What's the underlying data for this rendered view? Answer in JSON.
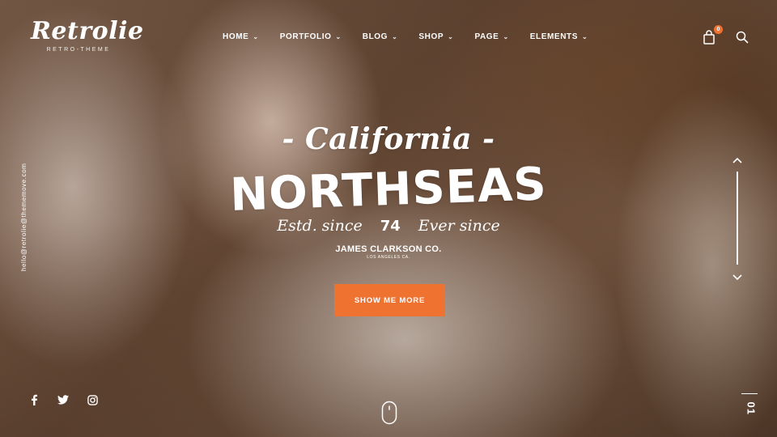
{
  "logo": {
    "name": "Retrolie",
    "tagline": "RETRO-THEME"
  },
  "nav": [
    {
      "label": "HOME"
    },
    {
      "label": "PORTFOLIO"
    },
    {
      "label": "BLOG"
    },
    {
      "label": "SHOP"
    },
    {
      "label": "PAGE"
    },
    {
      "label": "ELEMENTS"
    }
  ],
  "cart": {
    "count": "0"
  },
  "side_email": "hello@retrolie@thememove.com",
  "hero": {
    "script_title": "- California -",
    "title": "NORTHSEAS",
    "estd_left": "Estd. since",
    "estd_year": "74",
    "estd_right": "Ever since",
    "company": "JAMES CLARKSON CO.",
    "location": "LOS ANGELES CA.",
    "cta_label": "SHOW ME MORE"
  },
  "slide": {
    "current": "01"
  },
  "colors": {
    "accent": "#f07230"
  },
  "icons": {
    "cart": "shopping-bag-icon",
    "search": "search-icon",
    "social": [
      "facebook-icon",
      "twitter-icon",
      "instagram-icon"
    ],
    "scroll": "mouse-icon"
  }
}
